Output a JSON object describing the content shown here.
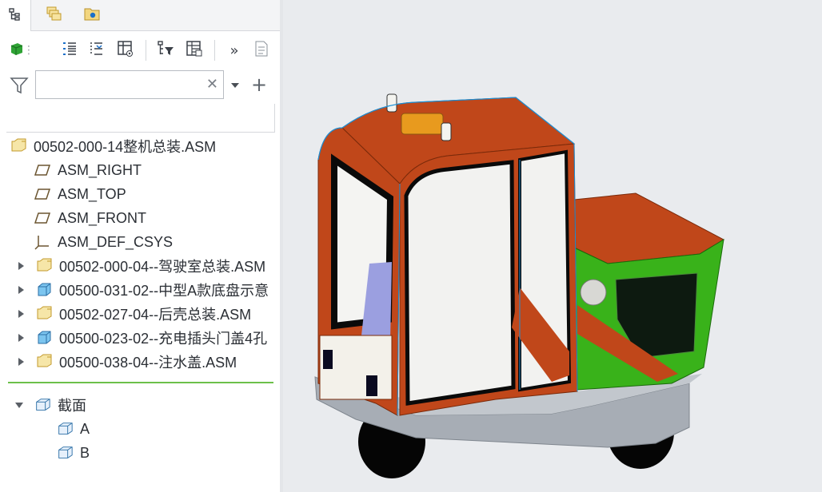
{
  "tabs": [
    {
      "name": "model-tree-tab",
      "icon": "tree-icon"
    },
    {
      "name": "layers-tab",
      "icon": "layers-icon"
    },
    {
      "name": "favorites-tab",
      "icon": "folder-star-icon"
    }
  ],
  "search": {
    "value": "",
    "placeholder": ""
  },
  "tree": {
    "root": "00502-000-14整机总装.ASM",
    "items": [
      {
        "label": "ASM_RIGHT",
        "type": "datum-plane"
      },
      {
        "label": "ASM_TOP",
        "type": "datum-plane"
      },
      {
        "label": "ASM_FRONT",
        "type": "datum-plane"
      },
      {
        "label": "ASM_DEF_CSYS",
        "type": "csys"
      },
      {
        "label": "00502-000-04--驾驶室总装.ASM",
        "type": "asm"
      },
      {
        "label": "00500-031-02--中型A款底盘示意",
        "type": "part"
      },
      {
        "label": "00502-027-04--后壳总装.ASM",
        "type": "asm"
      },
      {
        "label": "00500-023-02--充电插头门盖4孔",
        "type": "part"
      },
      {
        "label": "00500-038-04--注水盖.ASM",
        "type": "asm"
      }
    ],
    "sections": {
      "label": "截面",
      "items": [
        "A",
        "B"
      ]
    }
  },
  "viewport_toolbar": [
    "refit-icon",
    "zoom-in-icon",
    "zoom-out-icon",
    "repaint-icon",
    "perspective-icon",
    "display-style-icon",
    "saved-views-icon",
    "named-view-icon",
    "section-icon",
    "plane-display-icon",
    "point-display-icon",
    "annotation-display-icon",
    "spin-center-icon",
    "warning-icon",
    "pause-icon",
    "appearance-icon"
  ],
  "colors": {
    "accent": "#1a8fd6",
    "cab_orange": "#c0471a",
    "rear_green": "#39b21a",
    "chassis_gray": "#a7adb5",
    "divider_green": "#6cc04a"
  }
}
